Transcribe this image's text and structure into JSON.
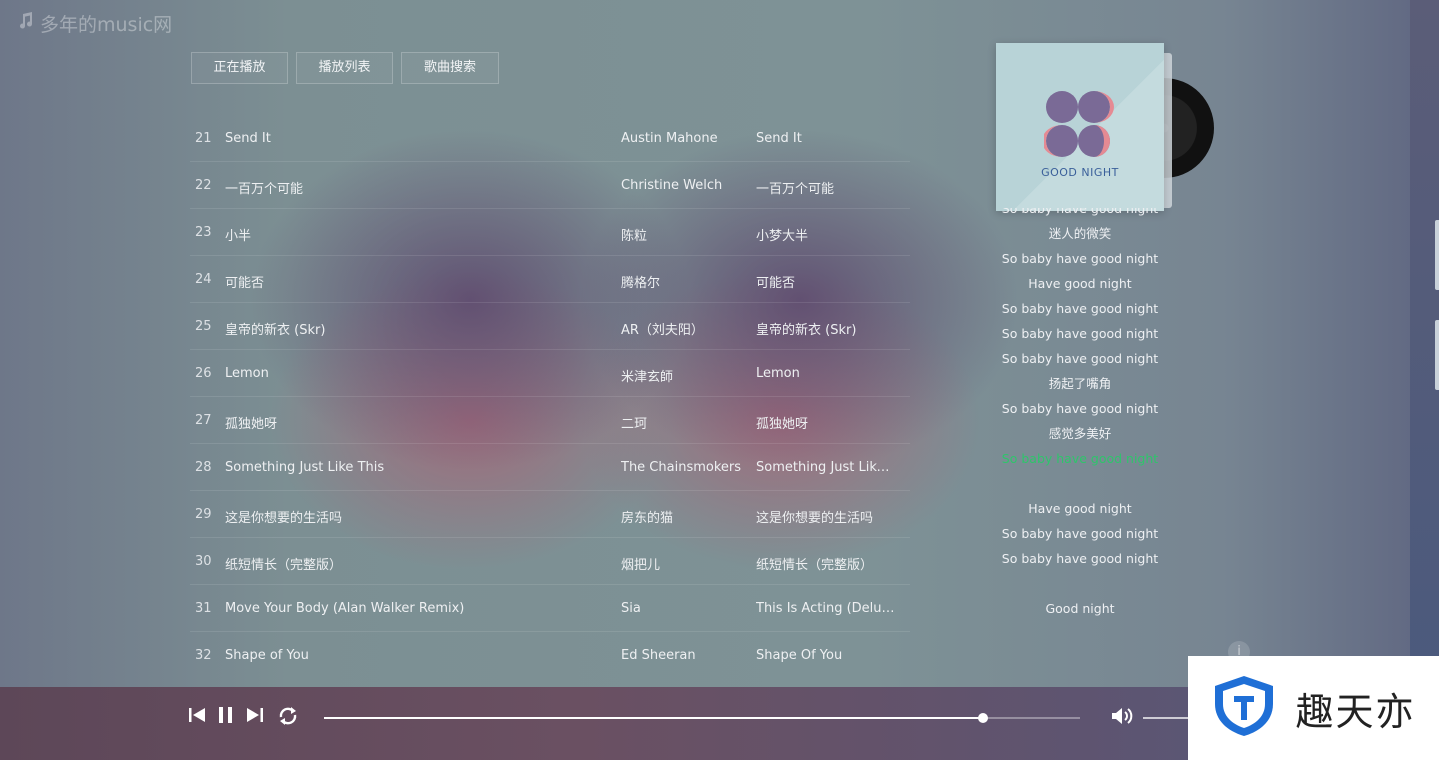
{
  "app": {
    "logo_text": "多年的music网"
  },
  "tabs": [
    {
      "label": "正在播放"
    },
    {
      "label": "播放列表"
    },
    {
      "label": "歌曲搜索"
    }
  ],
  "playlist": [
    {
      "num": "21",
      "name": "Send It",
      "artist": "Austin Mahone",
      "album": "Send It"
    },
    {
      "num": "22",
      "name": "一百万个可能",
      "artist": "Christine Welch",
      "album": "一百万个可能"
    },
    {
      "num": "23",
      "name": "小半",
      "artist": "陈粒",
      "album": "小梦大半"
    },
    {
      "num": "24",
      "name": "可能否",
      "artist": "腾格尔",
      "album": "可能否"
    },
    {
      "num": "25",
      "name": "皇帝的新衣 (Skr)",
      "artist": "AR（刘夫阳）",
      "album": "皇帝的新衣 (Skr)"
    },
    {
      "num": "26",
      "name": "Lemon",
      "artist": "米津玄師",
      "album": "Lemon"
    },
    {
      "num": "27",
      "name": "孤独她呀",
      "artist": "二珂",
      "album": "孤独她呀"
    },
    {
      "num": "28",
      "name": "Something Just Like This",
      "artist": "The Chainsmokers",
      "album": "Something Just Like T..."
    },
    {
      "num": "29",
      "name": "这是你想要的生活吗",
      "artist": "房东的猫",
      "album": "这是你想要的生活吗"
    },
    {
      "num": "30",
      "name": "纸短情长（完整版）",
      "artist": "烟把儿",
      "album": "纸短情长（完整版）"
    },
    {
      "num": "31",
      "name": "Move Your Body (Alan Walker Remix)",
      "artist": "Sia",
      "album": "This Is Acting (Deluxe..."
    },
    {
      "num": "32",
      "name": "Shape of You",
      "artist": "Ed Sheeran",
      "album": "Shape Of You"
    }
  ],
  "cover": {
    "caption": "GOOD NIGHT"
  },
  "lyrics": [
    "So baby have good night",
    "迷人的微笑",
    "So baby have good night",
    "Have good night",
    "So baby have good night",
    "So baby have good night",
    "So baby have good night",
    "扬起了嘴角",
    "So baby have good night",
    "感觉多美好",
    "So baby have good night",
    "",
    "Have good night",
    "So baby have good night",
    "So baby have good night",
    "",
    "Good night"
  ],
  "lyrics_active_index": 10,
  "player": {
    "progress": 0.872
  },
  "colors": {
    "active_lyric": "#2ec56b",
    "player_bg": "#65505f"
  },
  "icons": [
    "music-note-icon",
    "prev-icon",
    "pause-icon",
    "next-icon",
    "repeat-icon",
    "volume-icon",
    "info-icon",
    "shield-logo-icon"
  ],
  "watermark": {
    "text": "趣天亦"
  }
}
